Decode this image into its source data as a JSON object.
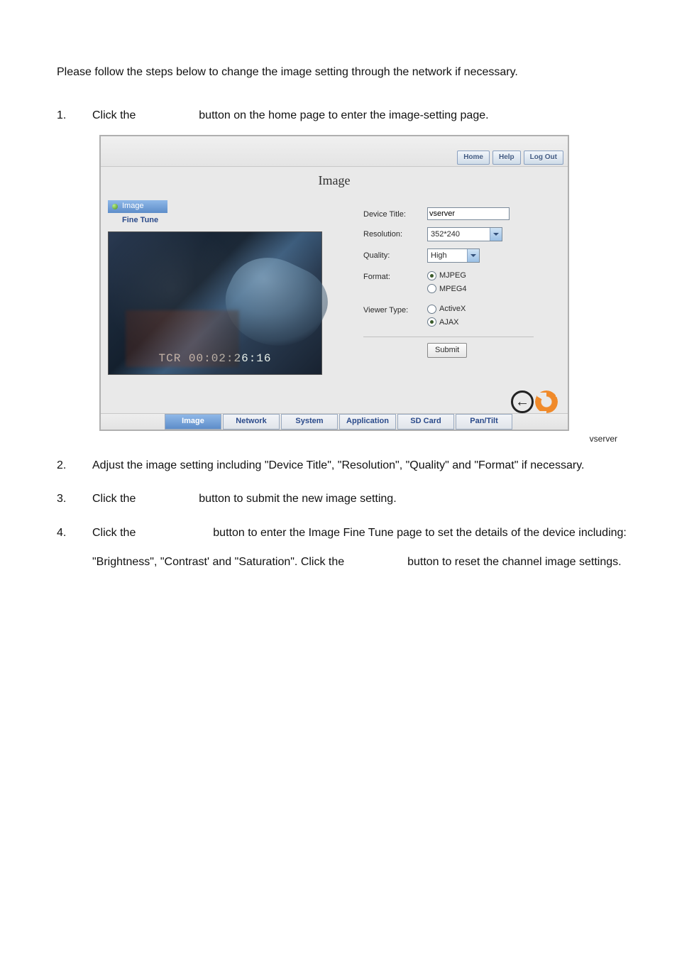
{
  "intro": "Please follow the steps below to change the image setting through the network if necessary.",
  "steps": {
    "1": {
      "num": "1.",
      "pre": "Click the",
      "post": "button on the home page to enter the image-setting page."
    },
    "2": {
      "num": "2.",
      "text": "Adjust the image setting including \"Device Title\", \"Resolution\", \"Quality\" and \"Format\" if necessary."
    },
    "3": {
      "num": "3.",
      "pre": "Click the",
      "post": "button to submit the new image setting."
    },
    "4": {
      "num": "4.",
      "pre": "Click the",
      "mid1": "button to enter the Image Fine Tune page to set the details of the device including: \"Brightness\", \"Contrast' and \"Saturation\". Click the",
      "mid2": "button to reset the channel image settings."
    }
  },
  "screenshot": {
    "top_buttons": {
      "home": "Home",
      "help": "Help",
      "logout": "Log Out"
    },
    "page_title": "Image",
    "side": {
      "image": "Image",
      "fine_tune": "Fine Tune"
    },
    "video_tcr": "TCR 00:02:26:16",
    "form": {
      "device_title_label": "Device Title:",
      "device_title_value": "vserver",
      "resolution_label": "Resolution:",
      "resolution_value": "352*240",
      "quality_label": "Quality:",
      "quality_value": "High",
      "format_label": "Format:",
      "format_mjpeg": "MJPEG",
      "format_mpeg4": "MPEG4",
      "viewer_label": "Viewer Type:",
      "viewer_activex": "ActiveX",
      "viewer_ajax": "AJAX",
      "submit": "Submit"
    },
    "nav": {
      "image": "Image",
      "network": "Network",
      "system": "System",
      "application": "Application",
      "sdcard": "SD Card",
      "pantilt": "Pan/Tilt"
    },
    "footer_brand": "vserver"
  }
}
